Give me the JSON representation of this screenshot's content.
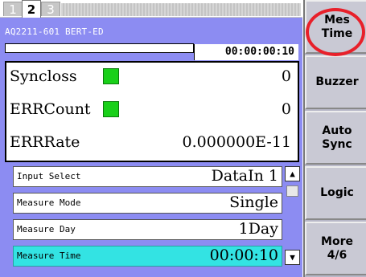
{
  "tabs": [
    {
      "label": "1",
      "active": false
    },
    {
      "label": "2",
      "active": true
    },
    {
      "label": "3",
      "active": false
    }
  ],
  "device": {
    "name": "AQ2211-601 BERT-ED"
  },
  "timer": {
    "elapsed": "00:00:00:10",
    "progress_fraction": 0.0
  },
  "results": {
    "syncloss": {
      "label": "Syncloss",
      "value": "0",
      "led_color": "#19d019"
    },
    "errcount": {
      "label": "ERRCount",
      "value": "0",
      "led_color": "#19d019"
    },
    "errrate": {
      "label": "ERRRate",
      "value": "0.000000E-11"
    }
  },
  "settings": [
    {
      "label": "Input Select",
      "value": "DataIn 1"
    },
    {
      "label": "Measure Mode",
      "value": "Single"
    },
    {
      "label": "Measure Day",
      "value": "1Day"
    },
    {
      "label": "Measure Time",
      "value": "00:00:10",
      "selected": true
    }
  ],
  "scrollbar": {
    "up_icon": "triangle-up",
    "down_icon": "triangle-down"
  },
  "softkeys": [
    {
      "label": "Mes\nTime",
      "highlighted": true
    },
    {
      "label": "Buzzer"
    },
    {
      "label": "Auto\nSync"
    },
    {
      "label": "Logic"
    },
    {
      "label": "More\n4/6"
    }
  ],
  "colors": {
    "panel": "#8c8cf2",
    "selected_row": "#33e3e3",
    "highlight_ring": "#e8202a",
    "softkey": "#c9c9d4"
  }
}
